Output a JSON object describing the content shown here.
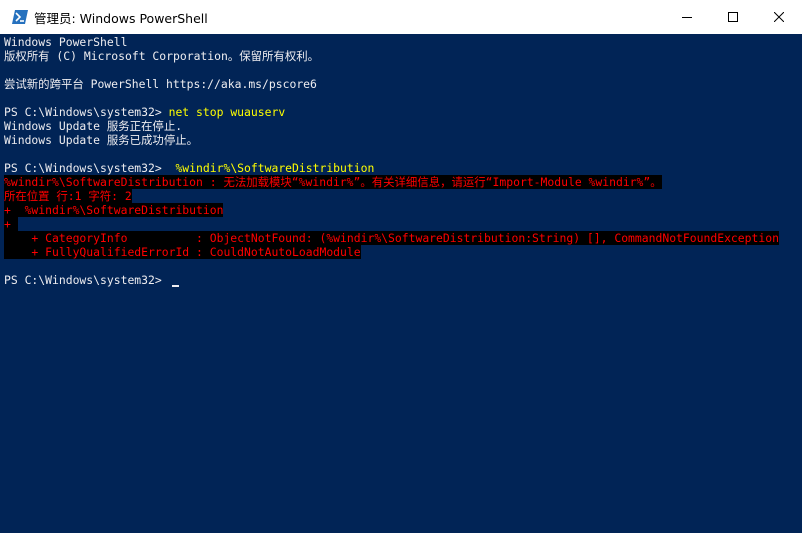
{
  "window": {
    "title": "管理员: Windows PowerShell",
    "icon": "powershell-icon",
    "controls": [
      "minimize-icon",
      "maximize-icon",
      "close-icon"
    ]
  },
  "colors": {
    "console_background": "#012456",
    "text": "#eeedf0",
    "command": "#ffff00",
    "error_text": "#ff0000",
    "error_background": "#000000"
  },
  "console": {
    "banner_1": "Windows PowerShell",
    "banner_2": "版权所有 (C) Microsoft Corporation。保留所有权利。",
    "banner_3": "尝试新的跨平台 PowerShell https://aka.ms/pscore6",
    "prompt": "PS C:\\Windows\\system32> ",
    "command_1": "net stop wuauserv",
    "output_1": "Windows Update 服务正在停止.",
    "output_2": "Windows Update 服务已成功停止。",
    "command_2": " %windir%\\SoftwareDistribution",
    "error_1": "%windir%\\SoftwareDistribution : 无法加载模块“%windir%”。有关详细信息，请运行“Import-Module %windir%”。",
    "error_2": "所在位置 行:1 字符: 2",
    "error_3": "+  %windir%\\SoftwareDistribution",
    "error_4": "+ ",
    "error_5": "    + CategoryInfo          : ObjectNotFound: (%windir%\\SoftwareDistribution:String) [], CommandNotFoundException",
    "error_6": "    + FullyQualifiedErrorId : CouldNotAutoLoadModule"
  }
}
